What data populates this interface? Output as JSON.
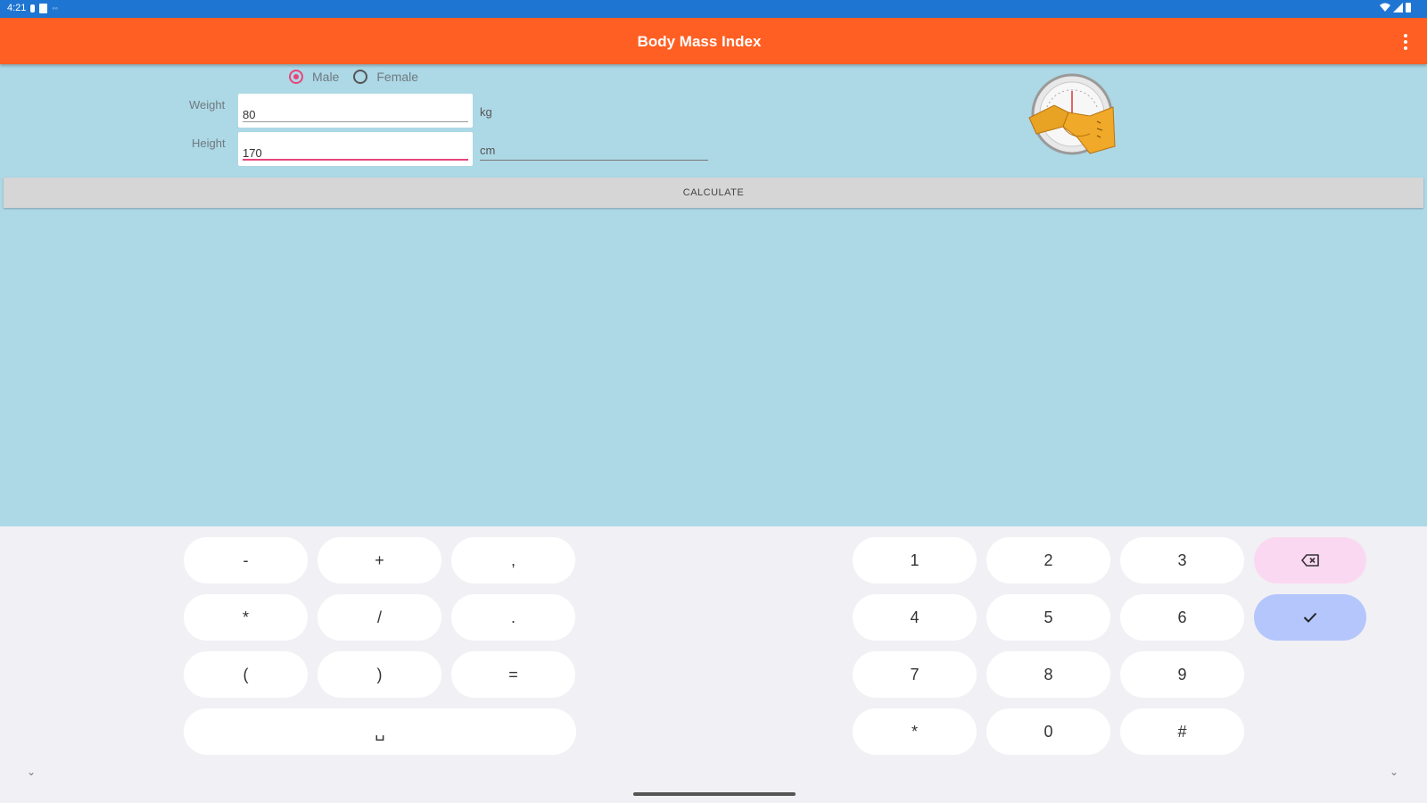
{
  "status_bar": {
    "time": "4:21"
  },
  "app_bar": {
    "title": "Body Mass Index",
    "menu_icon": "more-vert-icon"
  },
  "form": {
    "gender": {
      "male_label": "Male",
      "female_label": "Female",
      "selected": "Male"
    },
    "weight": {
      "label": "Weight",
      "value": "80",
      "unit": "kg"
    },
    "height": {
      "label": "Height",
      "value": "170",
      "unit": "cm"
    },
    "calculate_label": "CALCULATE"
  },
  "keyboard": {
    "symbol_keys": [
      "-",
      "+",
      ",",
      "*",
      "/",
      ".",
      "(",
      ")",
      "="
    ],
    "space_key": "␣",
    "digit_keys": [
      "1",
      "2",
      "3",
      "4",
      "5",
      "6",
      "7",
      "8",
      "9",
      "*",
      "0",
      "#"
    ],
    "backspace_icon": "backspace-icon",
    "enter_icon": "check-icon"
  },
  "colors": {
    "status_bar": "#1e76d2",
    "app_bar": "#ff5f23",
    "background": "#add8e6",
    "accent": "#e8457a",
    "keyboard_bg": "#f1f0f4",
    "backspace_key": "#fbd8f1",
    "enter_key": "#b4c6fb"
  }
}
